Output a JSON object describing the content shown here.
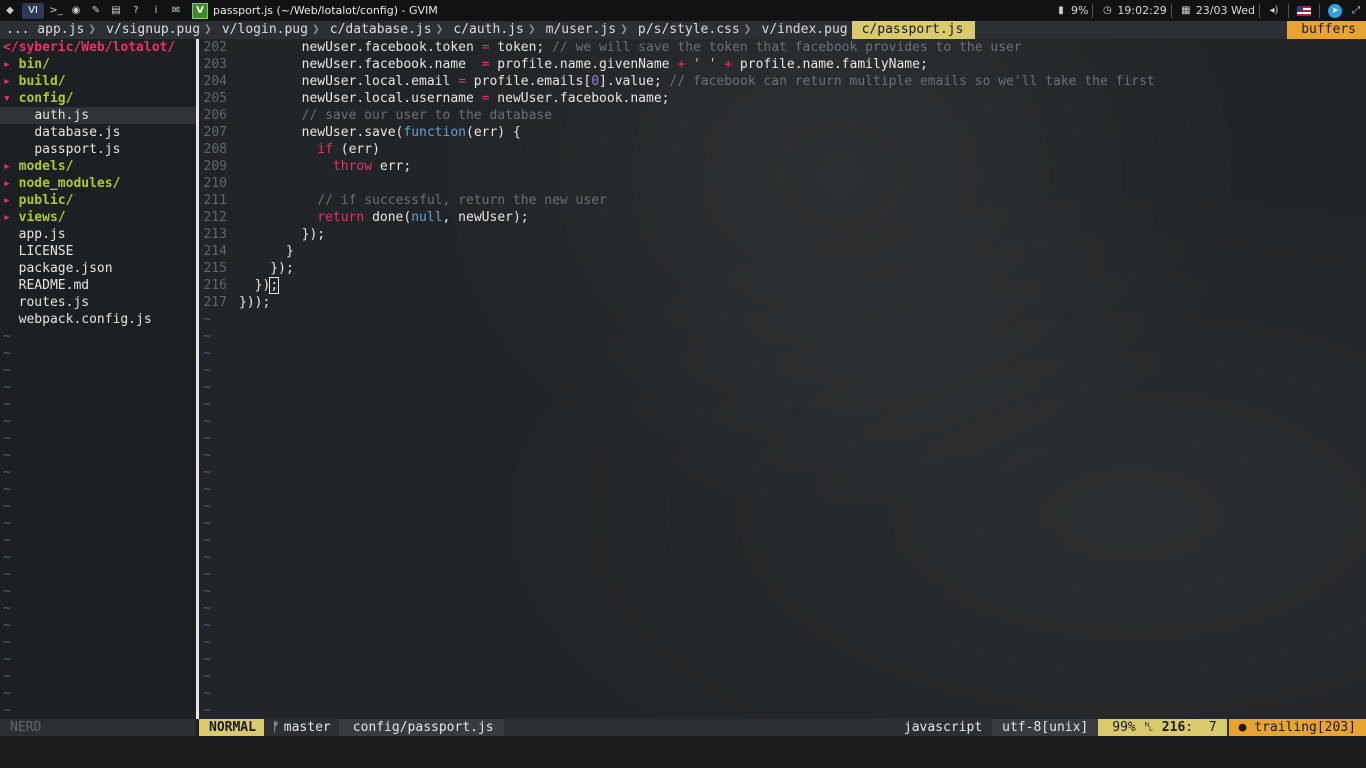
{
  "panel": {
    "launcher_items": [
      "VI",
      ">_"
    ],
    "window_title": "passport.js (~/Web/lotalot/config) - GVIM",
    "battery": "9%",
    "time": "19:02:29",
    "date": "23/03 Wed"
  },
  "tabline": {
    "tabs": [
      {
        "label": "... app.js"
      },
      {
        "label": "v/signup.pug"
      },
      {
        "label": "v/login.pug"
      },
      {
        "label": "c/database.js"
      },
      {
        "label": "c/auth.js"
      },
      {
        "label": "m/user.js"
      },
      {
        "label": "p/s/style.css"
      },
      {
        "label": "v/index.pug"
      }
    ],
    "active_tab": "c/passport.js",
    "buffers_label": "buffers"
  },
  "tree": {
    "root": "</syberic/Web/lotalot/",
    "items": [
      {
        "label": "bin/",
        "type": "dir",
        "marker": "▸"
      },
      {
        "label": "build/",
        "type": "dir",
        "marker": "▸"
      },
      {
        "label": "config/",
        "type": "dir",
        "marker": "▾"
      },
      {
        "label": "auth.js",
        "type": "file",
        "indent": 2
      },
      {
        "label": "database.js",
        "type": "file",
        "indent": 2
      },
      {
        "label": "passport.js",
        "type": "file",
        "indent": 2
      },
      {
        "label": "models/",
        "type": "dir",
        "marker": "▸"
      },
      {
        "label": "node_modules/",
        "type": "dir",
        "marker": "▸"
      },
      {
        "label": "public/",
        "type": "dir",
        "marker": "▸"
      },
      {
        "label": "views/",
        "type": "dir",
        "marker": "▸"
      },
      {
        "label": "app.js",
        "type": "file",
        "indent": 1
      },
      {
        "label": "LICENSE",
        "type": "file",
        "indent": 1
      },
      {
        "label": "package.json",
        "type": "file",
        "indent": 1
      },
      {
        "label": "README.md",
        "type": "file",
        "indent": 1
      },
      {
        "label": "routes.js",
        "type": "file",
        "indent": 1
      },
      {
        "label": "webpack.config.js",
        "type": "file",
        "indent": 1
      }
    ],
    "tilde": "~"
  },
  "editor": {
    "lines": [
      {
        "n": "202",
        "tokens": [
          [
            "t",
            "        newUser.facebook.token "
          ],
          [
            "op",
            "="
          ],
          [
            "t",
            " token; "
          ],
          [
            "cm",
            "// we will save the token that facebook provides to the user"
          ]
        ]
      },
      {
        "n": "203",
        "tokens": [
          [
            "t",
            "        newUser.facebook.name  "
          ],
          [
            "op",
            "="
          ],
          [
            "t",
            " profile.name.givenName "
          ],
          [
            "op",
            "+"
          ],
          [
            "t",
            " "
          ],
          [
            "st",
            "' '"
          ],
          [
            "t",
            " "
          ],
          [
            "op",
            "+"
          ],
          [
            "t",
            " profile.name.familyName;"
          ]
        ]
      },
      {
        "n": "204",
        "tokens": [
          [
            "t",
            "        newUser.local.email "
          ],
          [
            "op",
            "="
          ],
          [
            "t",
            " profile.emails["
          ],
          [
            "nm",
            "0"
          ],
          [
            "t",
            "].value; "
          ],
          [
            "cm",
            "// facebook can return multiple emails so we'll take the first"
          ]
        ]
      },
      {
        "n": "205",
        "tokens": [
          [
            "t",
            "        newUser.local.username "
          ],
          [
            "op",
            "="
          ],
          [
            "t",
            " newUser.facebook.name;"
          ]
        ]
      },
      {
        "n": "206",
        "tokens": [
          [
            "cm",
            "        // save our user to the database"
          ]
        ]
      },
      {
        "n": "207",
        "tokens": [
          [
            "t",
            "        newUser.save("
          ],
          [
            "fn",
            "function"
          ],
          [
            "t",
            "(err) {"
          ]
        ]
      },
      {
        "n": "208",
        "tokens": [
          [
            "t",
            "          "
          ],
          [
            "kw",
            "if"
          ],
          [
            "t",
            " (err)"
          ]
        ]
      },
      {
        "n": "209",
        "tokens": [
          [
            "t",
            "            "
          ],
          [
            "kw",
            "throw"
          ],
          [
            "t",
            " err;"
          ]
        ]
      },
      {
        "n": "210",
        "tokens": [
          [
            "t",
            ""
          ]
        ]
      },
      {
        "n": "211",
        "tokens": [
          [
            "cm",
            "          // if successful, return the new user"
          ]
        ]
      },
      {
        "n": "212",
        "tokens": [
          [
            "t",
            "          "
          ],
          [
            "kw",
            "return"
          ],
          [
            "t",
            " done("
          ],
          [
            "fn",
            "null"
          ],
          [
            "t",
            ", newUser);"
          ]
        ]
      },
      {
        "n": "213",
        "tokens": [
          [
            "t",
            "        });"
          ]
        ]
      },
      {
        "n": "214",
        "tokens": [
          [
            "t",
            "      }"
          ]
        ]
      },
      {
        "n": "215",
        "tokens": [
          [
            "t",
            "    });"
          ]
        ]
      },
      {
        "n": "216",
        "tokens": [
          [
            "t",
            "  })"
          ],
          [
            "cur",
            ";"
          ]
        ]
      },
      {
        "n": "217",
        "tokens": [
          [
            "t",
            "}));"
          ]
        ]
      }
    ],
    "tilde": "~"
  },
  "status": {
    "nerd_label": "NERD",
    "mode": "NORMAL",
    "branch_icon": "ᚠ",
    "branch": "master",
    "file": "config/passport.js",
    "filetype": "javascript",
    "encoding": "utf-8[unix]",
    "percent": "99%",
    "line_symbol": "␤",
    "line": "216",
    "col": "7",
    "trailing": "● trailing[203]"
  }
}
